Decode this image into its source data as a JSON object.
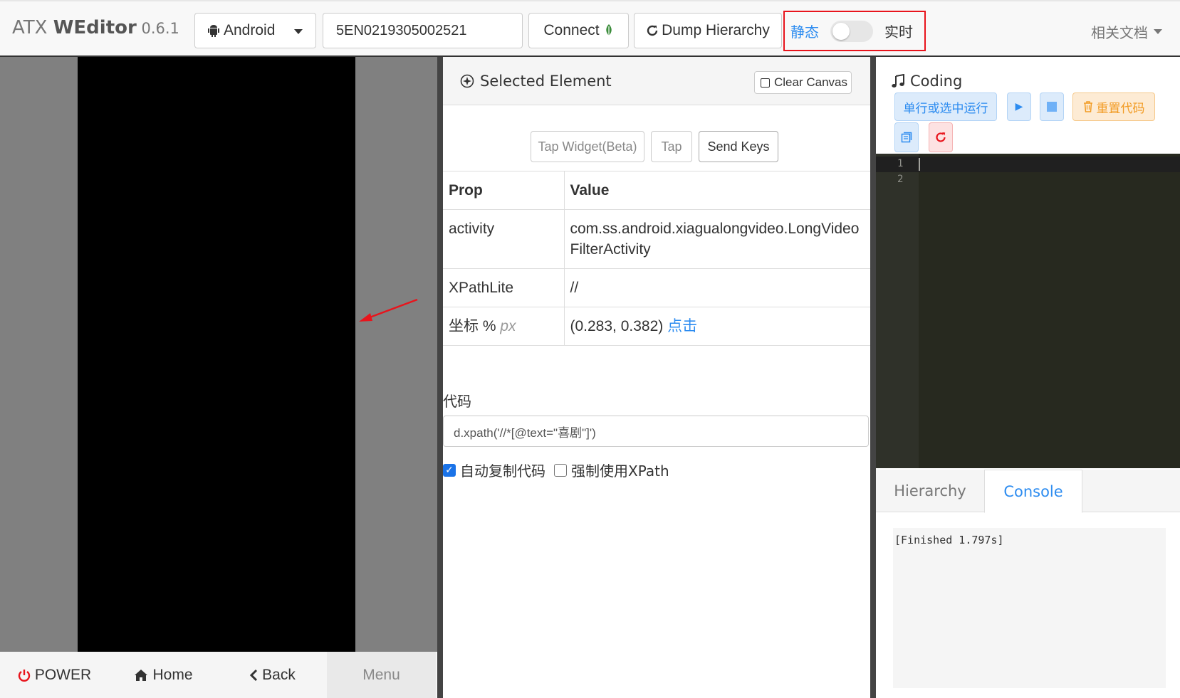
{
  "navbar": {
    "brand_prefix": "ATX ",
    "brand_bold": "WEditor",
    "brand_version": " 0.6.1",
    "platform_label": "Android",
    "serial_value": "5EN0219305002521",
    "connect_label": "Connect",
    "dump_label": "Dump Hierarchy",
    "mode_static": "静态",
    "mode_live": "实时",
    "docs_label": "相关文档"
  },
  "device": {
    "power_label": "POWER",
    "home_label": "Home",
    "back_label": "Back",
    "menu_label": "Menu"
  },
  "selected": {
    "title": "Selected Element",
    "clear_canvas": "Clear Canvas",
    "tap_widget": "Tap Widget(Beta)",
    "tap": "Tap",
    "send_keys": "Send Keys",
    "table": {
      "head_prop": "Prop",
      "head_value": "Value",
      "activity_prop": "activity",
      "activity_value": "com.ss.android.xiagualongvideo.LongVideoFilterActivity",
      "xpath_prop": "XPathLite",
      "xpath_value": "//",
      "coord_prop": "坐标",
      "coord_pct": "%",
      "coord_px": "px",
      "coord_value": "(0.283, 0.382)",
      "coord_action": "点击"
    },
    "code_label": "代码",
    "code_value": "d.xpath('//*[@text=\"喜剧\"]')",
    "auto_copy_label": "自动复制代码",
    "force_xpath_label": "强制使用XPath"
  },
  "coding": {
    "title": "Coding",
    "run_selected": "单行或选中运行",
    "reset_code": "重置代码",
    "line_1": "1",
    "line_2": "2",
    "tab_hierarchy": "Hierarchy",
    "tab_console": "Console",
    "console_output": "[Finished 1.797s]"
  },
  "colors": {
    "accent": "#2d8cf0",
    "highlight_border": "#e8141c",
    "editor_bg": "#27291f"
  }
}
